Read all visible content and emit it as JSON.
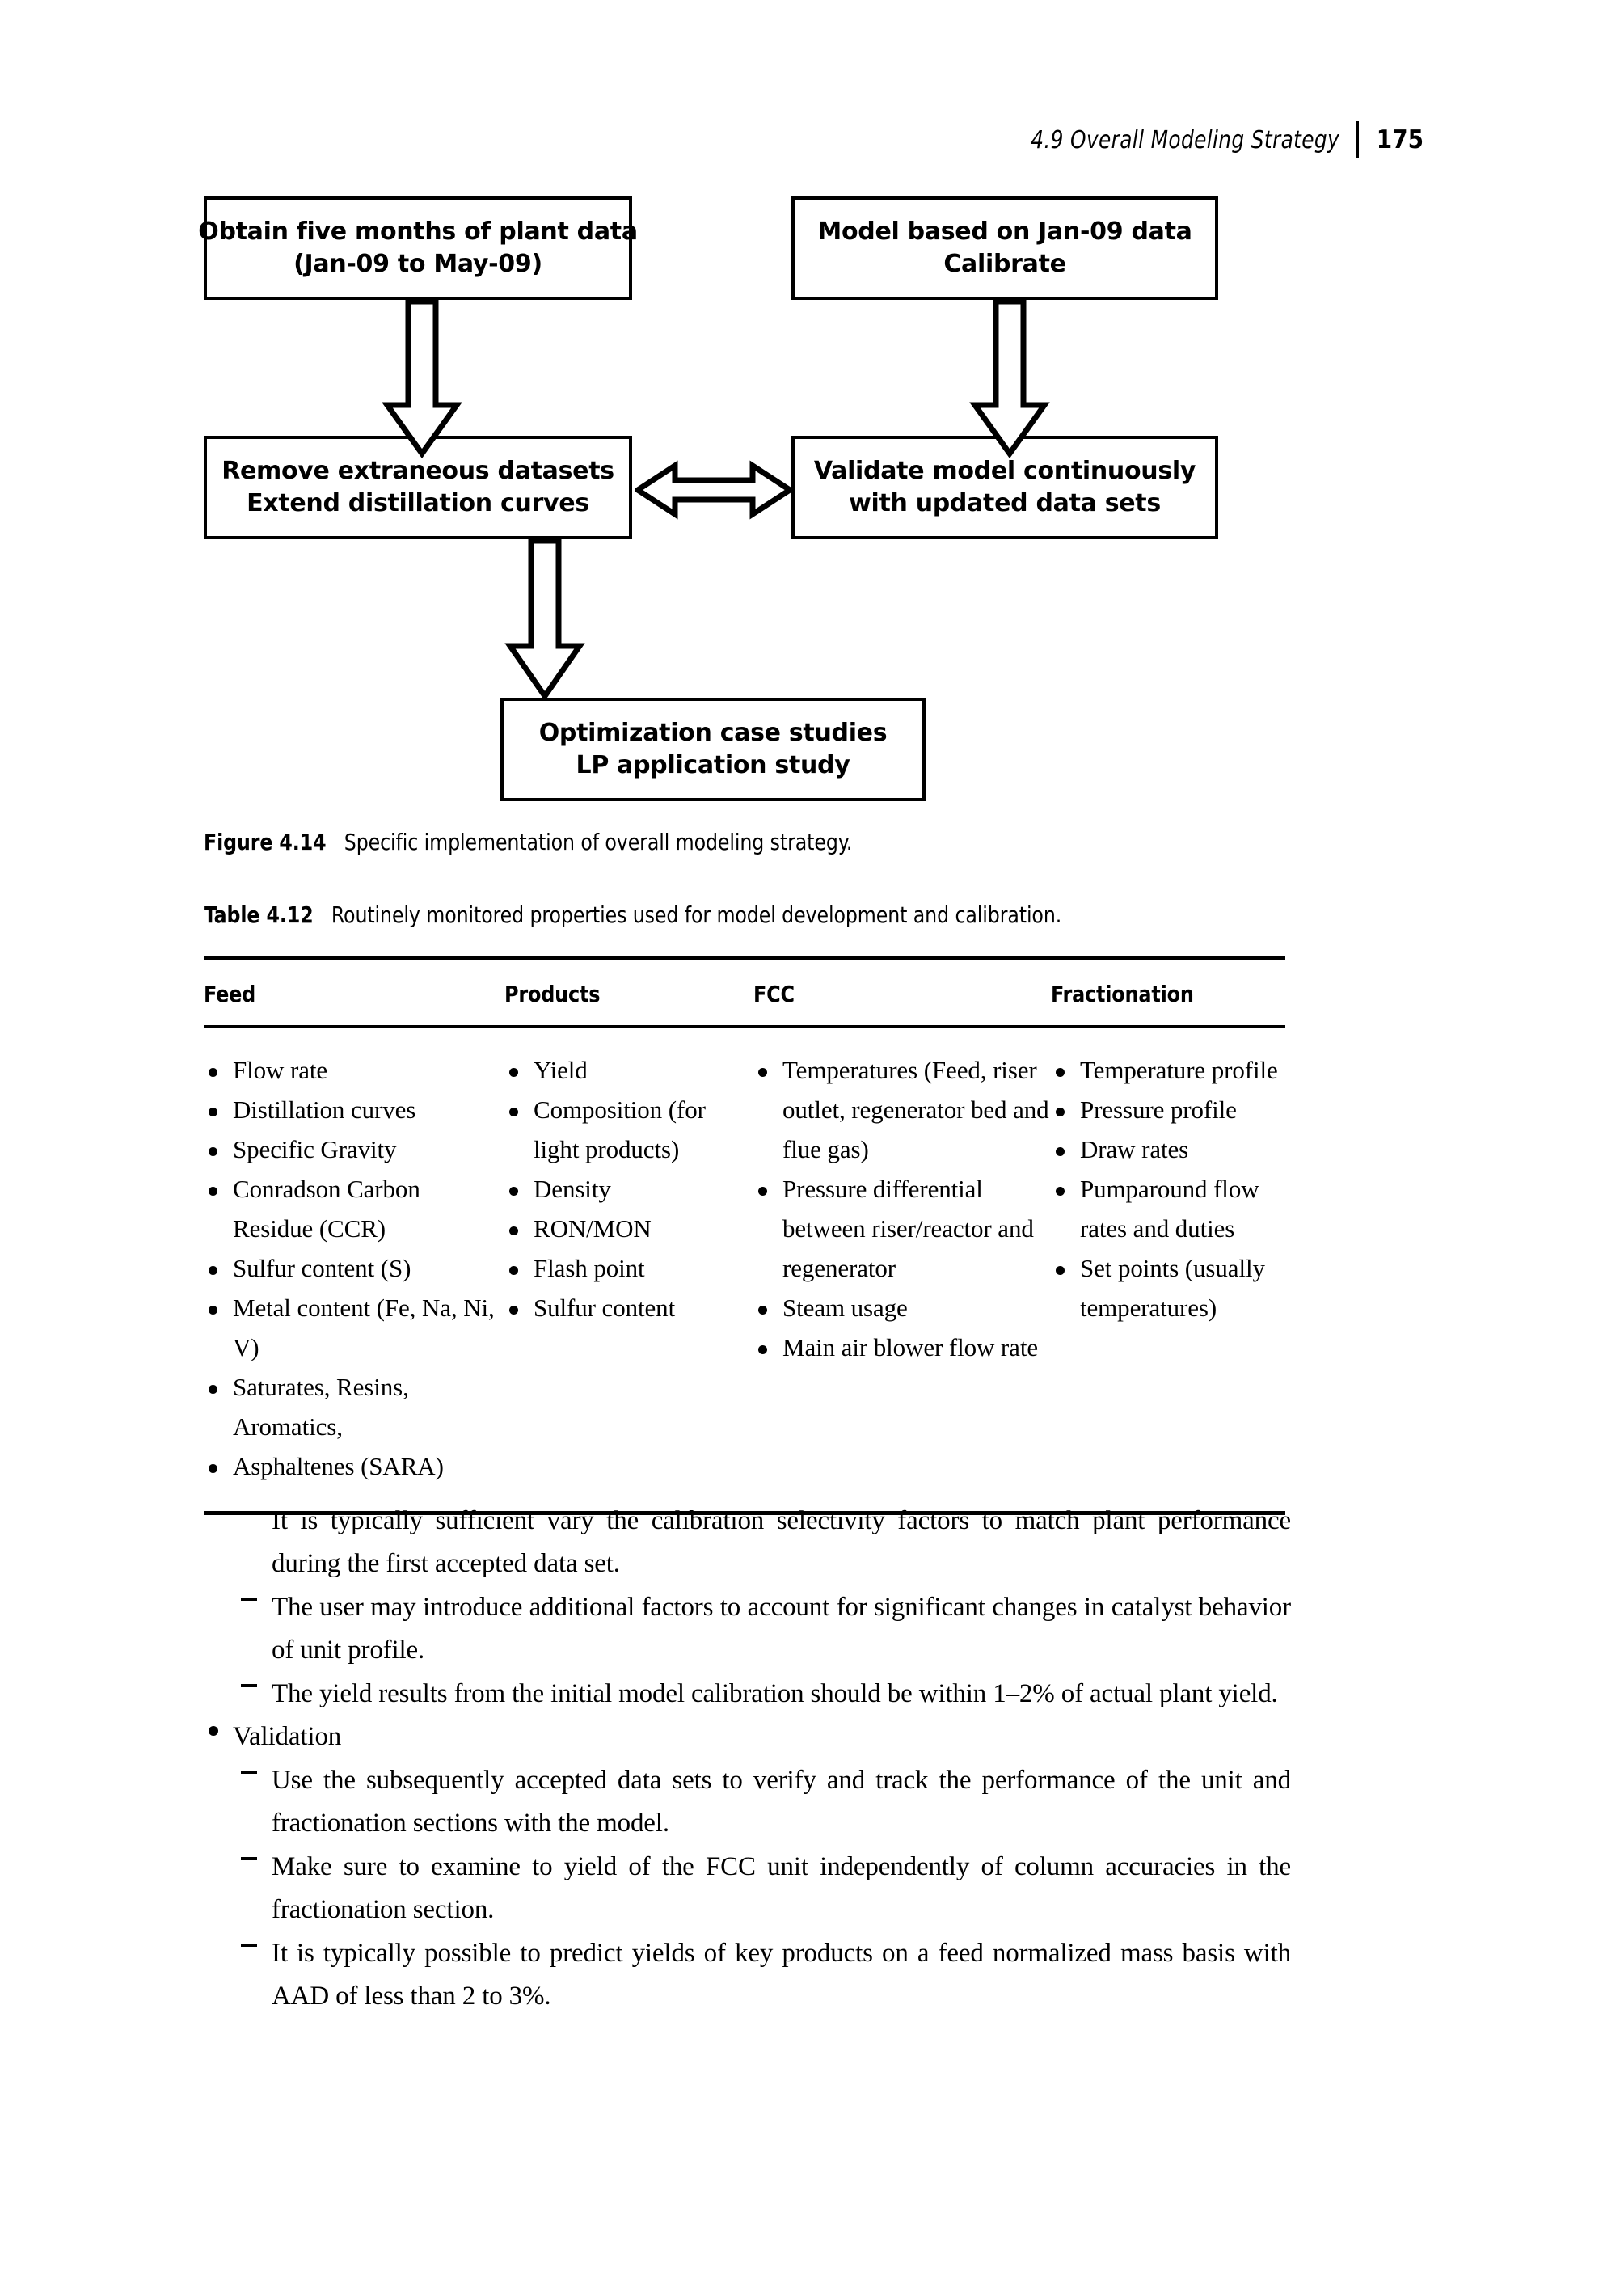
{
  "running_head": {
    "section": "4.9  Overall Modeling Strategy",
    "page_number": "175"
  },
  "figure": {
    "boxes": [
      {
        "id": "obtain",
        "line1": "Obtain five months of plant data",
        "line2": "(Jan-09 to May-09)"
      },
      {
        "id": "model",
        "line1": "Model based on Jan-09 data",
        "line2": "Calibrate"
      },
      {
        "id": "remove",
        "line1": "Remove extraneous datasets",
        "line2": "Extend distillation curves"
      },
      {
        "id": "validate",
        "line1": "Validate model continuously",
        "line2": "with updated data sets"
      },
      {
        "id": "optim",
        "line1": "Optimization case studies",
        "line2": "LP application study"
      }
    ],
    "caption_label": "Figure 4.14",
    "caption_text": "Specific implementation of overall modeling strategy."
  },
  "table": {
    "caption_label": "Table 4.12",
    "caption_text": "Routinely monitored properties used for model development and calibration.",
    "headers": [
      "Feed",
      "Products",
      "FCC",
      "Fractionation"
    ],
    "columns": {
      "feed": [
        "Flow rate",
        "Distillation curves",
        "Specific Gravity",
        "Conradson Carbon Residue (CCR)",
        "Sulfur content (S)",
        "Metal content (Fe, Na, Ni, V)",
        "Saturates, Resins, Aromatics,",
        "Asphaltenes (SARA)"
      ],
      "products": [
        "Yield",
        "Composition (for light products)",
        "Density",
        "RON/MON",
        "Flash point",
        "Sulfur content"
      ],
      "fcc": [
        "Temperatures (Feed, riser outlet, regenerator bed and flue gas)",
        "Pressure differential between riser/reactor and regenerator",
        "Steam usage",
        "Main air blower flow rate"
      ],
      "fractionation": [
        "Temperature profile",
        "Pressure profile",
        "Draw rates",
        "Pumparound flow rates and duties",
        "Set points (usually temperatures)"
      ]
    }
  },
  "body": {
    "items": [
      {
        "level": 2,
        "text": "It is typically sufficient vary the calibration selectivity factors to match plant performance during the first accepted data set."
      },
      {
        "level": 2,
        "text": "The user may introduce additional factors to account for significant changes in catalyst behavior of unit profile."
      },
      {
        "level": 2,
        "text": "The yield results from the initial model calibration should be within 1–2% of actual plant yield."
      },
      {
        "level": 1,
        "text": "Validation"
      },
      {
        "level": 2,
        "text": "Use the subsequently accepted data sets to verify and track the performance of the unit and fractionation sections with the model."
      },
      {
        "level": 2,
        "text": "Make sure to examine to yield of the FCC unit independently of column accuracies in the fractionation section."
      },
      {
        "level": 2,
        "text": "It is typically possible to predict yields of key products on a feed normalized mass basis with AAD of less than 2 to 3%."
      }
    ]
  }
}
